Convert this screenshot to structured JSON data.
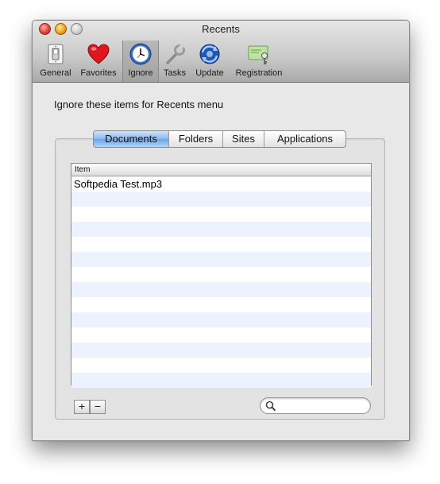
{
  "window": {
    "title": "Recents"
  },
  "toolbar": {
    "items": [
      {
        "label": "General",
        "icon": "light-switch-icon"
      },
      {
        "label": "Favorites",
        "icon": "heart-icon"
      },
      {
        "label": "Ignore",
        "icon": "clock-icon",
        "selected": true
      },
      {
        "label": "Tasks",
        "icon": "wrench-icon"
      },
      {
        "label": "Update",
        "icon": "sync-globe-icon"
      },
      {
        "label": "Registration",
        "icon": "license-key-icon"
      }
    ]
  },
  "main": {
    "prompt": "Ignore these items for Recents menu",
    "tabs": [
      {
        "label": "Documents",
        "active": true
      },
      {
        "label": "Folders"
      },
      {
        "label": "Sites"
      },
      {
        "label": "Applications"
      }
    ],
    "table": {
      "header": "Item",
      "rows": [
        "Softpedia Test.mp3"
      ]
    },
    "add_label": "+",
    "remove_label": "−",
    "search_placeholder": ""
  },
  "colors": {
    "tab_active": "#6aa3ea",
    "row_stripe": "#edf3fe"
  }
}
